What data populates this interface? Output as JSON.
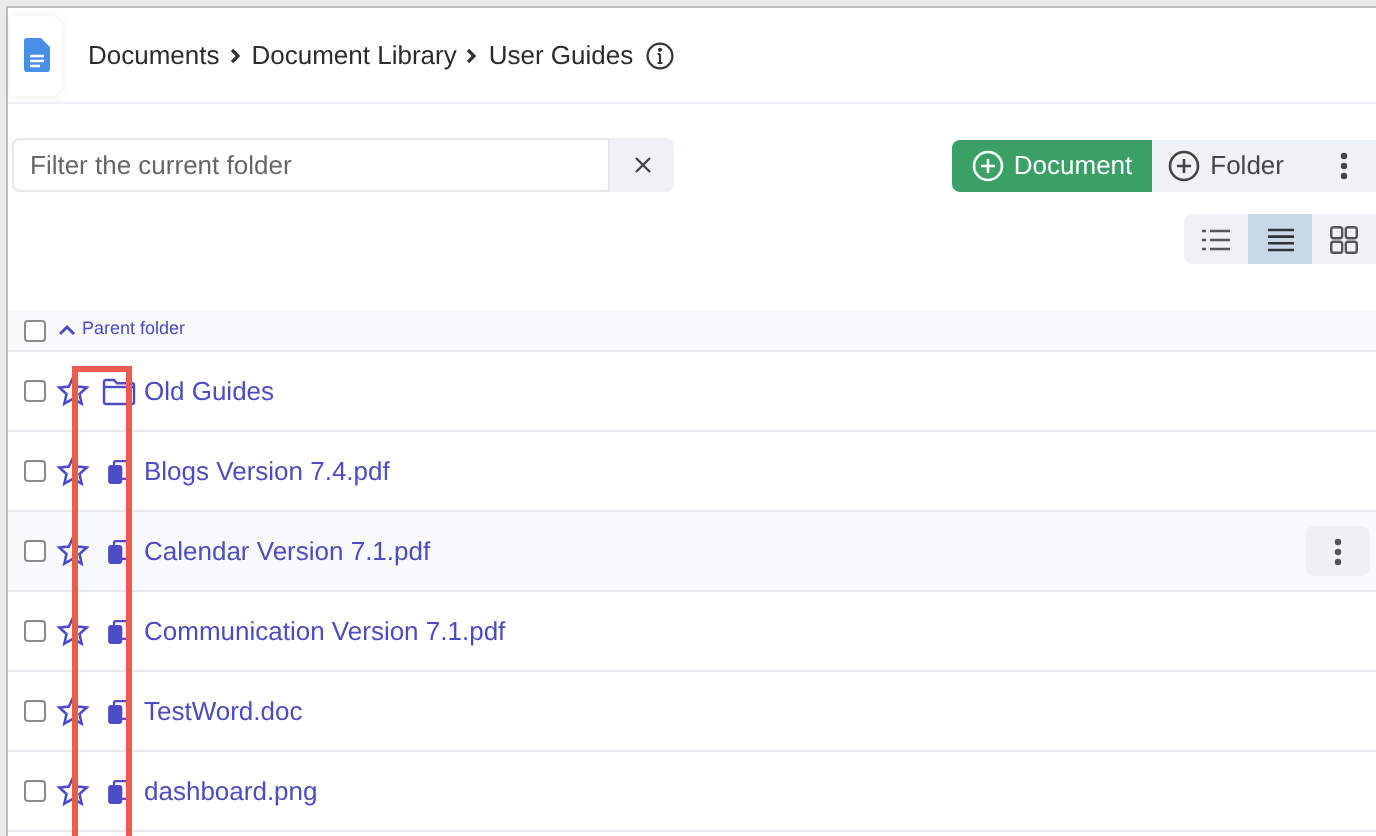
{
  "breadcrumb": [
    {
      "label": "Documents"
    },
    {
      "label": "Document Library"
    },
    {
      "label": "User Guides"
    }
  ],
  "filter": {
    "placeholder": "Filter the current folder"
  },
  "actions": [
    {
      "label": "Document",
      "kind": "primary"
    },
    {
      "label": "Folder",
      "kind": "secondary"
    }
  ],
  "view_modes": [
    {
      "kind": "list",
      "selected": false
    },
    {
      "kind": "table",
      "selected": true
    },
    {
      "kind": "cards",
      "selected": false
    }
  ],
  "list": {
    "select_all": false,
    "parent_link": "Parent folder",
    "rows": [
      {
        "name": "Old Guides",
        "kind": "folder",
        "checked": false,
        "starred": false,
        "highlighted": false
      },
      {
        "name": "Blogs Version 7.4.pdf",
        "kind": "file",
        "checked": false,
        "starred": false,
        "highlighted": false
      },
      {
        "name": "Calendar Version 7.1.pdf",
        "kind": "file",
        "checked": false,
        "starred": false,
        "highlighted": true
      },
      {
        "name": "Communication Version 7.1.pdf",
        "kind": "file",
        "checked": false,
        "starred": false,
        "highlighted": false
      },
      {
        "name": "TestWord.doc",
        "kind": "file",
        "checked": false,
        "starred": false,
        "highlighted": false
      },
      {
        "name": "dashboard.png",
        "kind": "file",
        "checked": false,
        "starred": false,
        "highlighted": false
      }
    ]
  }
}
